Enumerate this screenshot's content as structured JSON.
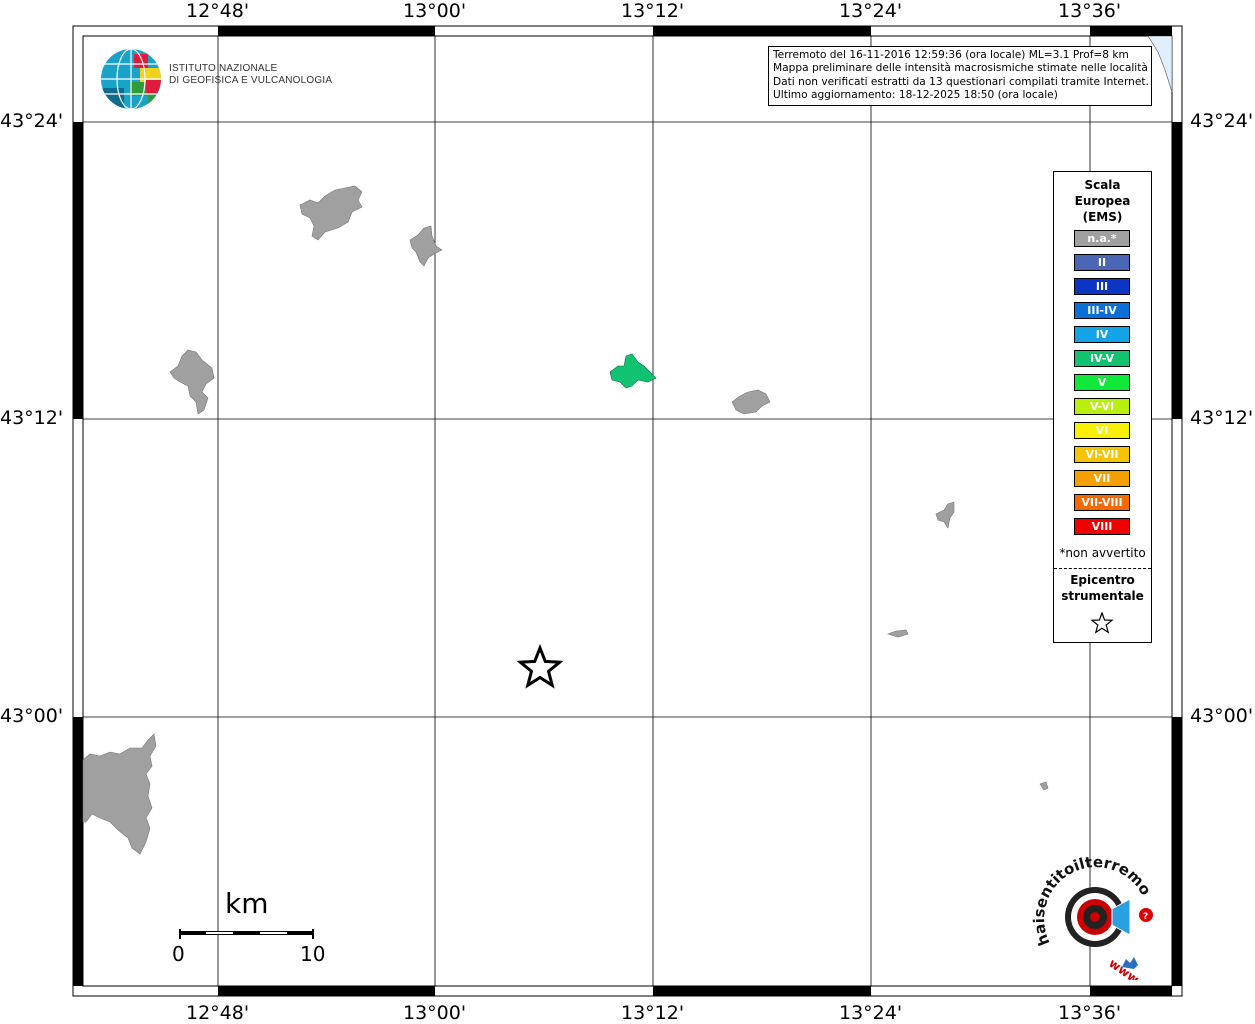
{
  "map": {
    "lon_ticks": [
      "12°48'",
      "13°00'",
      "13°12'",
      "13°24'",
      "13°36'"
    ],
    "lat_ticks": [
      "43°24'",
      "43°12'",
      "43°00'"
    ],
    "colors": {
      "frame": "#000000",
      "grid": "#000000",
      "land_na": "#a0a0a0",
      "intensity_iv_v": "#11c370",
      "sea": "#dfeefa"
    }
  },
  "info": {
    "line1": "Terremoto del 16-11-2016 12:59:36 (ora locale) ML=3.1 Prof=8 km",
    "line2": "Mappa preliminare delle intensità macrosismiche stimate nelle località",
    "line3": "Dati non verificati estratti da 13 questionari compilati tramite Internet.",
    "line4": "Ultimo aggiornamento: 18-12-2025 18:50 (ora locale)"
  },
  "logo": {
    "line1": "ISTITUTO NAZIONALE",
    "line2": "DI GEOFISICA E VULCANOLOGIA"
  },
  "legend": {
    "title1": "Scala",
    "title2": "Europea",
    "title3": "(EMS)",
    "items": [
      {
        "label": "n.a.*",
        "color": "#a0a0a0"
      },
      {
        "label": "II",
        "color": "#4a66b4"
      },
      {
        "label": "III",
        "color": "#0c35c4"
      },
      {
        "label": "III-IV",
        "color": "#0a70d8"
      },
      {
        "label": "IV",
        "color": "#13a3e8"
      },
      {
        "label": "IV-V",
        "color": "#11c370"
      },
      {
        "label": "V",
        "color": "#10e83a"
      },
      {
        "label": "V-VI",
        "color": "#b8f00c"
      },
      {
        "label": "VI",
        "color": "#f8f000"
      },
      {
        "label": "VI-VII",
        "color": "#f6c400"
      },
      {
        "label": "VII",
        "color": "#f6a000"
      },
      {
        "label": "VII-VIII",
        "color": "#f46a00"
      },
      {
        "label": "VIII",
        "color": "#f00000"
      }
    ],
    "note": "*non avvertito",
    "epi1": "Epicentro",
    "epi2": "strumentale"
  },
  "scale_bar": {
    "unit": "km",
    "start": "0",
    "end": "10"
  },
  "hsentito": {
    "text": "haisentitoilterremoto.it",
    "www": "www."
  }
}
